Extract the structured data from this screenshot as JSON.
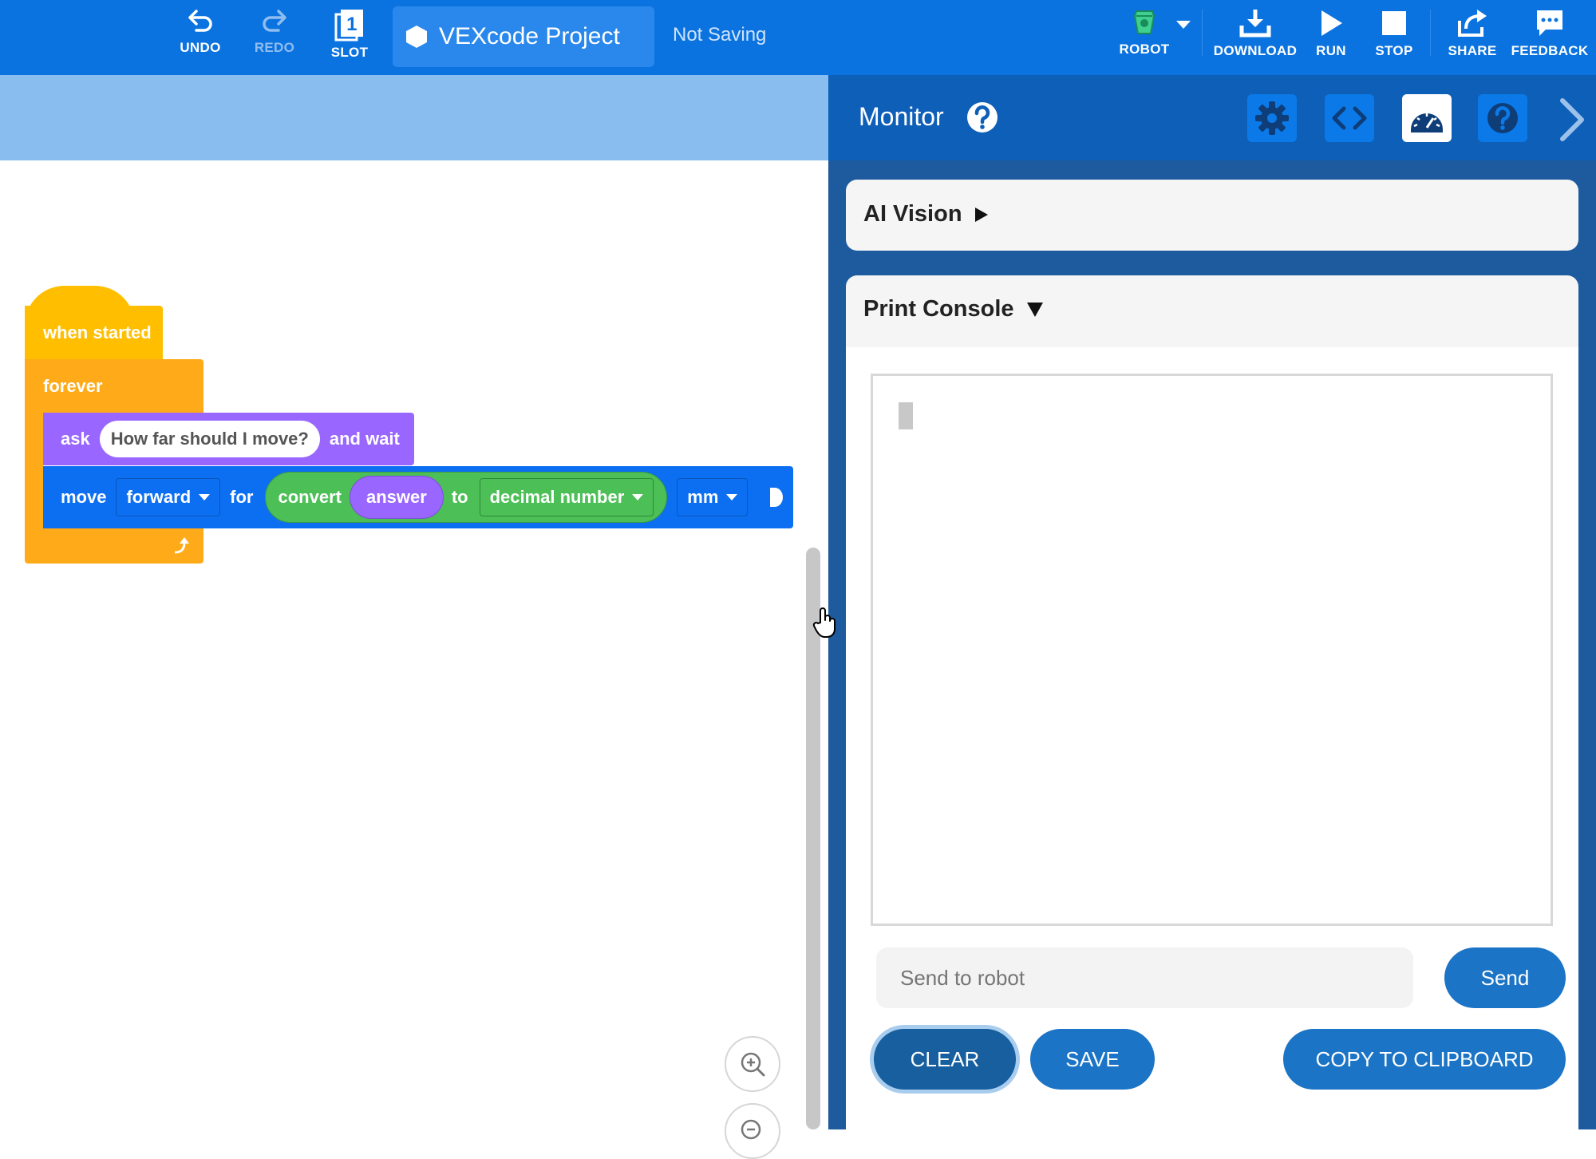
{
  "toolbar": {
    "undo_label": "UNDO",
    "redo_label": "REDO",
    "slot_label": "SLOT",
    "slot_number": "1",
    "project_name": "VEXcode Project",
    "save_status": "Not Saving",
    "robot_label": "ROBOT",
    "download_label": "DOWNLOAD",
    "run_label": "RUN",
    "stop_label": "STOP",
    "share_label": "SHARE",
    "feedback_label": "FEEDBACK"
  },
  "blocks": {
    "hat": "when started",
    "forever": "forever",
    "ask": {
      "prefix": "ask",
      "question": "How far should I move?",
      "suffix": "and wait"
    },
    "move": {
      "prefix": "move",
      "direction": "forward",
      "for": "for",
      "convert": "convert",
      "answer": "answer",
      "to": "to",
      "type": "decimal number",
      "unit": "mm"
    }
  },
  "monitor": {
    "title": "Monitor",
    "sections": {
      "ai_vision": "AI Vision",
      "print_console": "Print Console"
    },
    "console": {
      "send_placeholder": "Send to robot",
      "send_label": "Send",
      "clear_label": "CLEAR",
      "save_label": "SAVE",
      "copy_label": "COPY TO CLIPBOARD"
    }
  },
  "colors": {
    "toolbar_bg": "#0b73e0",
    "events_yellow": "#ffbf00",
    "control_orange": "#ffab19",
    "sensing_purple": "#9966ff",
    "drivetrain_blue": "#0c6ff2",
    "operators_green": "#4cbf56",
    "monitor_bg": "#1e5b9e",
    "button_blue": "#1b74c5"
  }
}
